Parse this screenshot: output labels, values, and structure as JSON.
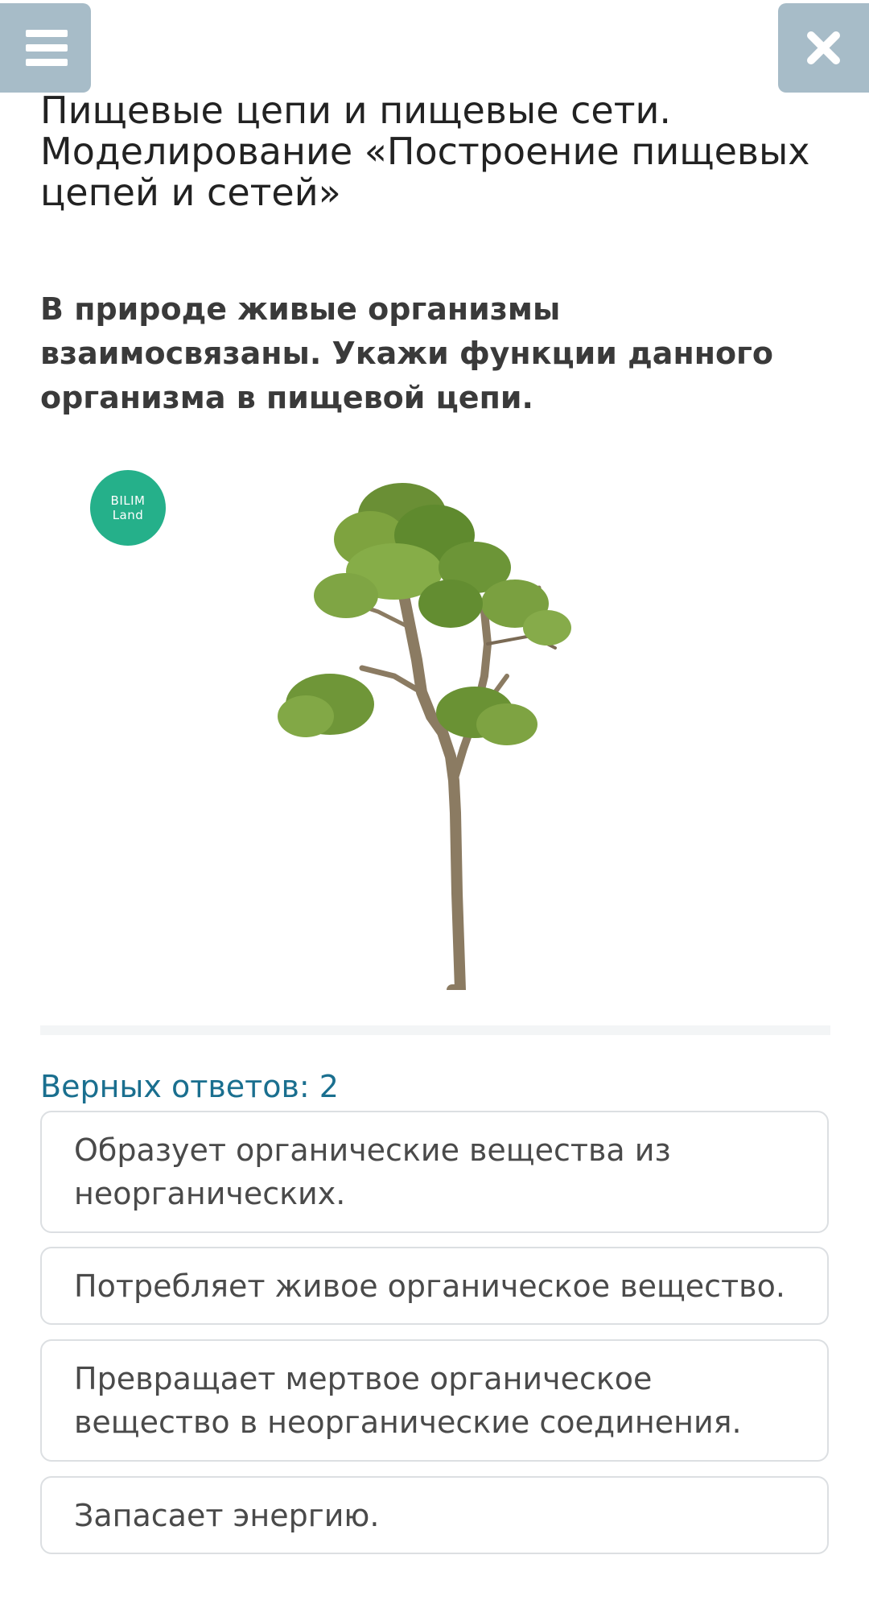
{
  "header": {
    "menu_icon": "hamburger-menu-icon",
    "close_icon": "close-icon",
    "button_color": "#a7bcc8"
  },
  "lesson": {
    "title": "Пищевые цепи и пищевые сети. Моделирование «Построение пищевых цепей и сетей»"
  },
  "question": {
    "text": "В природе живые организмы взаимосвязаны. Укажи функции данного организма в пищевой цепи."
  },
  "image": {
    "logo_line1": "BILIM",
    "logo_line2": "Land",
    "logo_color": "#25b08a"
  },
  "answers": {
    "count_label": "Верных ответов: 2",
    "options": [
      "Образует органические вещества из неорганических.",
      "Потребляет живое органическое вещество.",
      "Превращает мертвое органическое вещество в неорганические соединения.",
      "Запасает энергию."
    ]
  }
}
